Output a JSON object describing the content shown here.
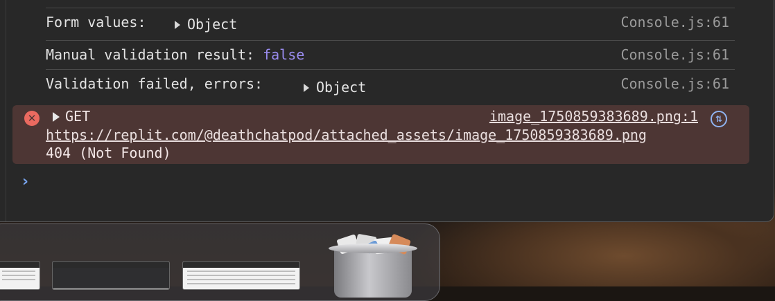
{
  "console": {
    "logs": [
      {
        "message": "Form values:",
        "object_label": "Object",
        "source": "Console.js:61"
      },
      {
        "message": "Manual validation result: ",
        "value": "false",
        "source": "Console.js:61"
      },
      {
        "message": "Validation failed, errors:",
        "object_label": "Object",
        "source": "Console.js:61"
      }
    ],
    "error": {
      "icon": "error-x-icon",
      "method": "GET",
      "source": "image_1750859383689.png:1",
      "url": "https://replit.com/@deathchatpod/attached_assets/image_1750859383689.png",
      "status": "404 (Not Found)",
      "network_icon": "network-request-icon"
    },
    "prompt_symbol": "›"
  },
  "dock": {
    "items": [
      {
        "name": "window-thumbnail-1"
      },
      {
        "name": "window-thumbnail-2"
      },
      {
        "name": "window-thumbnail-3"
      },
      {
        "name": "trash-full-icon"
      }
    ]
  },
  "colors": {
    "console_bg": "#282828",
    "error_bg": "#4d3634",
    "error_icon": "#ea6a60",
    "keyword_false": "#9a8cf0",
    "prompt": "#79a6f0"
  }
}
